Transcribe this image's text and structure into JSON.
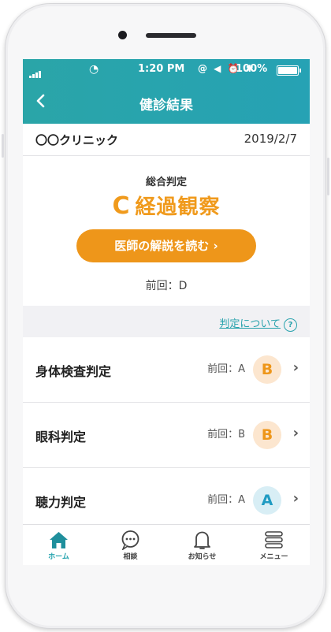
{
  "status_bar": {
    "time": "1:20 PM",
    "battery": "100%"
  },
  "header": {
    "back_icon": "chevron-left-icon",
    "title": "健診結果"
  },
  "clinic": {
    "name": "〇〇クリニック",
    "date": "2019/2/7"
  },
  "summary": {
    "label": "総合判定",
    "grade": "C",
    "grade_text": "経過観察",
    "button_label": "医師の解説を読む ›",
    "previous": "前回：D",
    "accent": "#ee961a"
  },
  "about": {
    "link_text": "判定について",
    "icon": "help-icon"
  },
  "results": [
    {
      "name": "身体検査判定",
      "previous": "前回：A",
      "grade": "B"
    },
    {
      "name": "眼科判定",
      "previous": "前回：B",
      "grade": "B"
    },
    {
      "name": "聴力判定",
      "previous": "前回：A",
      "grade": "A"
    }
  ],
  "tabs": [
    {
      "label": "ホーム",
      "icon": "home-icon"
    },
    {
      "label": "相談",
      "icon": "chat-icon"
    },
    {
      "label": "お知らせ",
      "icon": "bell-icon"
    },
    {
      "label": "メニュー",
      "icon": "menu-icon"
    }
  ],
  "colors": {
    "teal": "#27a3ad",
    "orange": "#ee961a",
    "grade_b_bg": "#fce6cf",
    "grade_a_bg": "#d8eef5"
  }
}
